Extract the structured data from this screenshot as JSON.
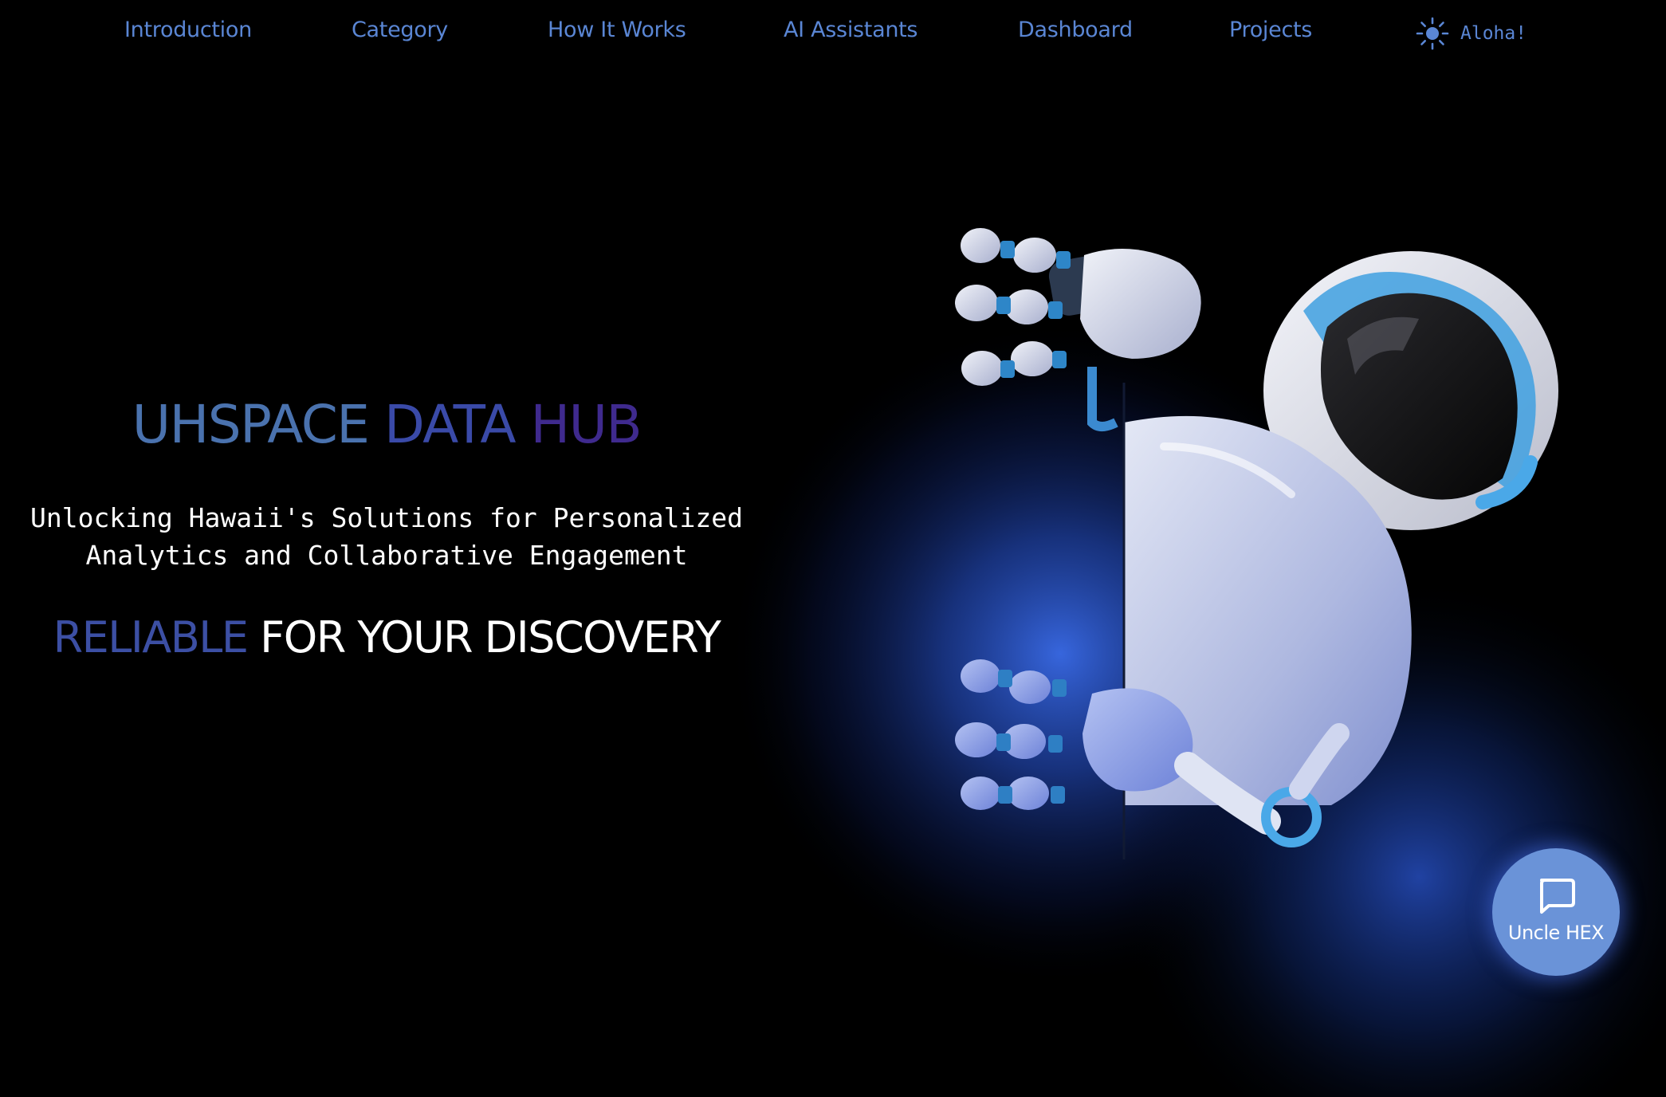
{
  "nav": {
    "items": [
      {
        "label": "Introduction"
      },
      {
        "label": "Category"
      },
      {
        "label": "How It Works"
      },
      {
        "label": "AI Assistants"
      },
      {
        "label": "Dashboard"
      },
      {
        "label": "Projects"
      }
    ],
    "theme_toggle": {
      "icon": "sun-icon",
      "label": "Aloha!"
    }
  },
  "hero": {
    "title_words": [
      "UHSPACE",
      "DATA",
      "HUB"
    ],
    "subtitle_line1": "Unlocking Hawaii's Solutions for Personalized",
    "subtitle_line2": "Analytics and Collaborative Engagement",
    "tagline_accent": "RELIABLE",
    "tagline_rest": "FOR YOUR DISCOVERY"
  },
  "chat": {
    "icon": "chat-bubble-icon",
    "label": "Uncle HEX"
  },
  "colors": {
    "background": "#000000",
    "nav_text": "#5a86d4",
    "title_gradient": [
      "#4a72ae",
      "#3a4aa8",
      "#3f2a8e"
    ],
    "tagline_accent": "#3c4fa4",
    "chat_button": "#6a93d8",
    "glow": "#2a55d6"
  }
}
